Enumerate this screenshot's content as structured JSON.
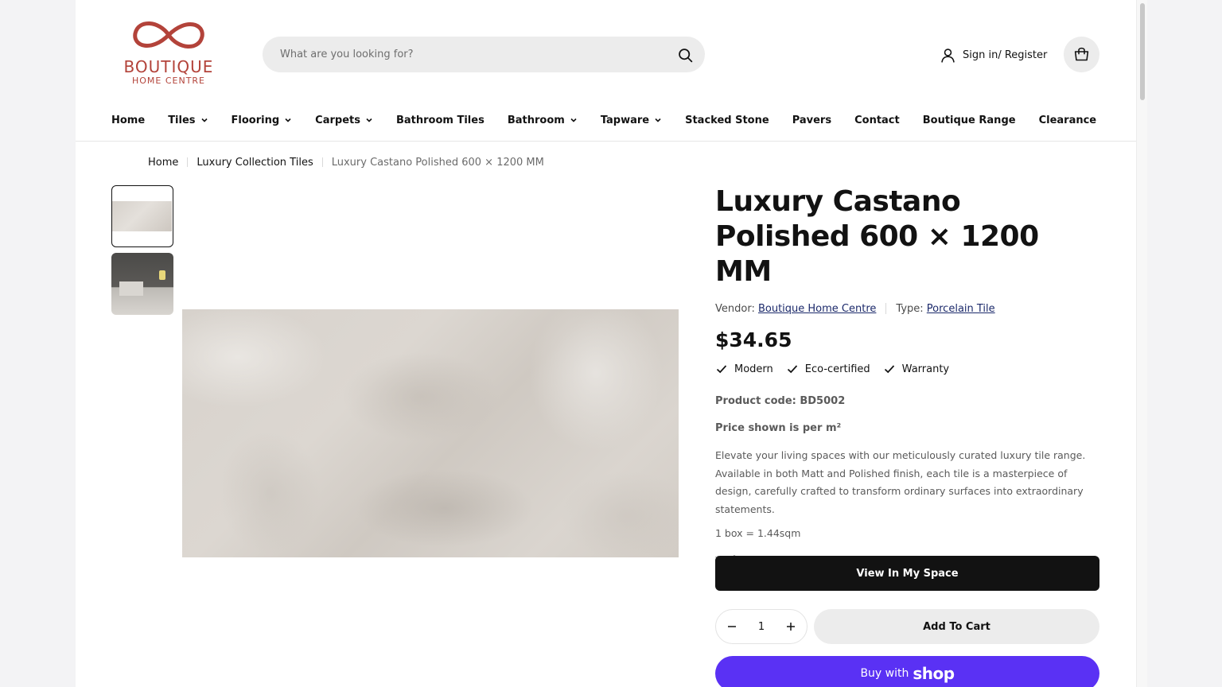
{
  "brand": {
    "name": "BOUTIQUE",
    "tagline": "HOME CENTRE",
    "color": "#b3433a"
  },
  "search": {
    "placeholder": "What are you looking for?",
    "value": "",
    "icon": "search-icon"
  },
  "account": {
    "label": "Sign in/ Register",
    "icon": "user-icon"
  },
  "cart": {
    "icon": "shopping-bag-icon"
  },
  "nav": {
    "items": [
      {
        "label": "Home",
        "has_dropdown": false
      },
      {
        "label": "Tiles",
        "has_dropdown": true
      },
      {
        "label": "Flooring",
        "has_dropdown": true
      },
      {
        "label": "Carpets",
        "has_dropdown": true
      },
      {
        "label": "Bathroom Tiles",
        "has_dropdown": false
      },
      {
        "label": "Bathroom",
        "has_dropdown": true
      },
      {
        "label": "Tapware",
        "has_dropdown": true
      },
      {
        "label": "Stacked Stone",
        "has_dropdown": false
      },
      {
        "label": "Pavers",
        "has_dropdown": false
      },
      {
        "label": "Contact",
        "has_dropdown": false
      },
      {
        "label": "Boutique Range",
        "has_dropdown": false
      },
      {
        "label": "Clearance",
        "has_dropdown": false
      }
    ]
  },
  "breadcrumb": {
    "items": [
      "Home",
      "Luxury Collection Tiles"
    ],
    "current": "Luxury Castano Polished 600 × 1200 MM"
  },
  "gallery": {
    "thumbnails": [
      "tile-swatch",
      "room-scene"
    ]
  },
  "product": {
    "title": "Luxury Castano Polished 600 × 1200 MM",
    "vendor_label": "Vendor:",
    "vendor": "Boutique Home Centre",
    "type_label": "Type:",
    "type": "Porcelain Tile",
    "price": "$34.65",
    "features": [
      "Modern",
      "Eco-certified",
      "Warranty"
    ],
    "code": "Product code: BD5002",
    "price_note": "Price shown is per m²",
    "description": "Elevate your living spaces with our meticulously curated luxury tile range. Available in both Matt and Polished finish, each tile is a masterpiece of design, carefully crafted to transform ordinary surfaces into extraordinary statements.",
    "box_info": "1 box = 1.44sqm",
    "disclaimer": "*Prices are per square metre."
  },
  "actions": {
    "view_in_space": "View In My Space",
    "quantity": "1",
    "add_to_cart": "Add To Cart",
    "buy_with": "Buy with",
    "shop_word": "shop"
  },
  "colors": {
    "accent_dark": "#121212",
    "link": "#1c2a6b",
    "shop_pay": "#5a31f4",
    "surface": "#ececec"
  }
}
